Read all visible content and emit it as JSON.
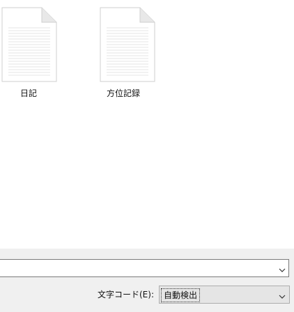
{
  "files": [
    {
      "name": "日記",
      "icon": "text-file-icon"
    },
    {
      "name": "方位記録",
      "icon": "text-file-icon"
    }
  ],
  "dialog": {
    "filename_value": "",
    "encoding_label": "文字コード(E):",
    "encoding_value": "自動検出"
  },
  "icons": {
    "dropdown": "chevron-down-icon"
  },
  "colors": {
    "panel_bg": "#f0f0f0",
    "select_bg": "#e5e5e5",
    "file_icon_fold": "#d4d4d4",
    "file_icon_lines": "#e0e0e0"
  }
}
